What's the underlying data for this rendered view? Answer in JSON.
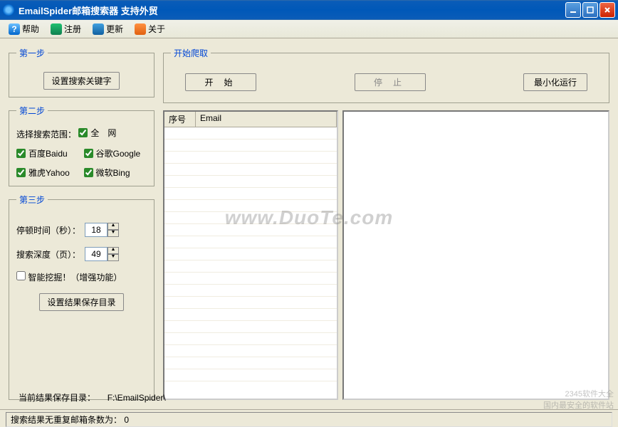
{
  "window": {
    "title": "EmailSpider邮箱搜索器 支持外贸"
  },
  "toolbar": {
    "help": "帮助",
    "register": "注册",
    "update": "更新",
    "about": "关于"
  },
  "step1": {
    "legend": "第一步",
    "set_keyword": "设置搜索关键字"
  },
  "step2": {
    "legend": "第二步",
    "scope_label": "选择搜索范围：",
    "all_net": "全　网",
    "baidu": "百度Baidu",
    "google": "谷歌Google",
    "yahoo": "雅虎Yahoo",
    "bing": "微软Bing"
  },
  "step3": {
    "legend": "第三步",
    "pause_label": "停顿时间（秒）：",
    "pause_value": "18",
    "depth_label": "搜索深度（页）：",
    "depth_value": "49",
    "smart_mining": "智能挖掘！（增强功能）",
    "set_result_dir": "设置结果保存目录"
  },
  "crawl": {
    "legend": "开始爬取",
    "start": "开 始",
    "stop": "停 止",
    "minimize_run": "最小化运行"
  },
  "listview": {
    "col_index": "序号",
    "col_email": "Email"
  },
  "result_path": {
    "label": "当前结果保存目录：",
    "value": "F:\\EmailSpider\\"
  },
  "statusbar": {
    "text": "搜索结果无重复邮箱条数为： 0"
  },
  "watermark": "www.DuoTe.com",
  "corner": {
    "line1": "2345软件大全",
    "line2": "国内最安全的软件站"
  }
}
